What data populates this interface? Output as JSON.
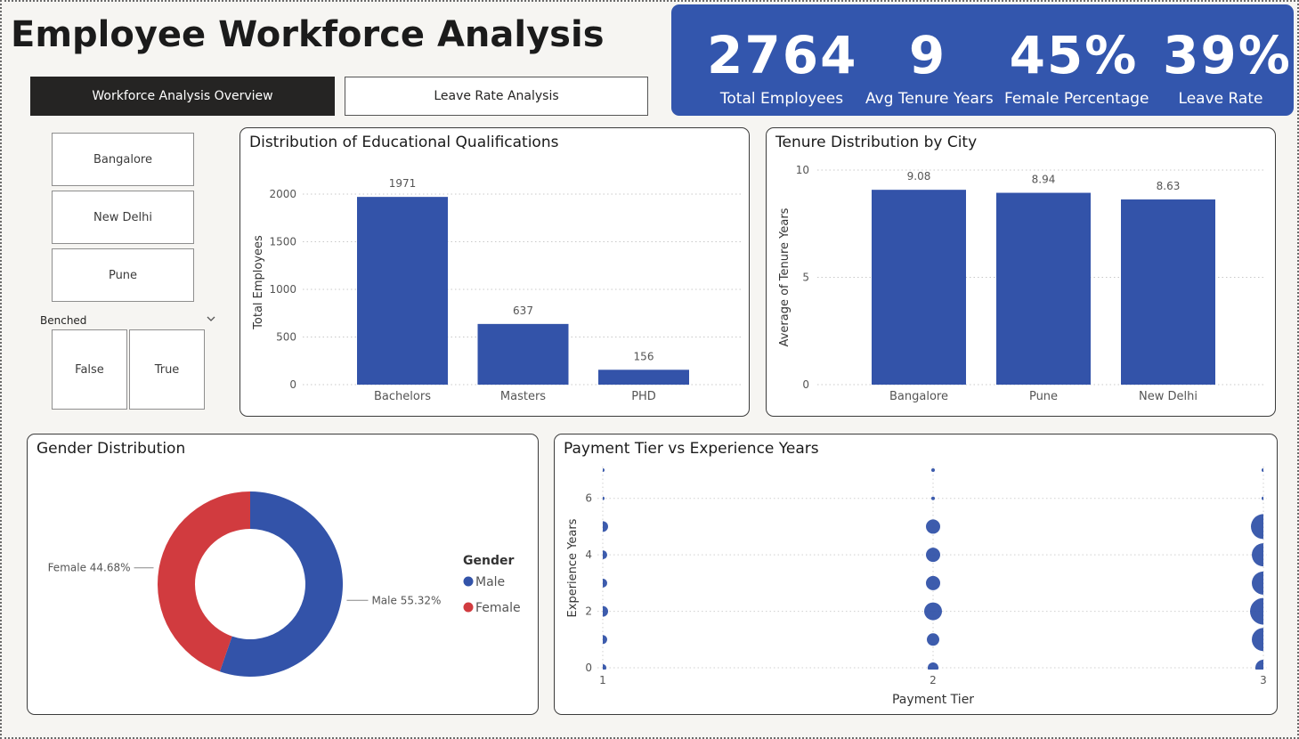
{
  "page": {
    "title": "Employee Workforce Analysis",
    "nav": {
      "active": "Workforce Analysis Overview",
      "inactive": "Leave Rate Analysis"
    }
  },
  "kpis": [
    {
      "value": "2764",
      "label": "Total Employees"
    },
    {
      "value": "9",
      "label": "Avg Tenure Years"
    },
    {
      "value": "45%",
      "label": "Female Percentage"
    },
    {
      "value": "39%",
      "label": "Leave Rate"
    }
  ],
  "colors": {
    "accent": "#3356ad",
    "bar": "#3353a9",
    "female": "#d13b3f",
    "dark": "#252423"
  },
  "slicers": {
    "cities": [
      "Bangalore",
      "New Delhi",
      "Pune"
    ],
    "benched": {
      "header": "Benched",
      "chevron_icon": "chevron-down-icon",
      "options": [
        "False",
        "True"
      ]
    }
  },
  "chart_data": [
    {
      "id": "education",
      "type": "bar",
      "title": "Distribution of Educational Qualifications",
      "xlabel": "",
      "ylabel": "Total Employees",
      "categories": [
        "Bachelors",
        "Masters",
        "PHD"
      ],
      "values": [
        1971,
        637,
        156
      ],
      "data_labels": [
        "1971",
        "637",
        "156"
      ],
      "yticks": [
        0,
        500,
        1000,
        1500,
        2000
      ],
      "ylim": [
        0,
        2150
      ],
      "grid": true
    },
    {
      "id": "tenure",
      "type": "bar",
      "title": "Tenure Distribution by City",
      "xlabel": "",
      "ylabel": "Average of Tenure Years",
      "categories": [
        "Bangalore",
        "Pune",
        "New Delhi"
      ],
      "values": [
        9.08,
        8.94,
        8.63
      ],
      "data_labels": [
        "9.08",
        "8.94",
        "8.63"
      ],
      "yticks": [
        0,
        5,
        10
      ],
      "ylim": [
        0,
        10
      ],
      "grid": true
    },
    {
      "id": "gender",
      "type": "pie",
      "subtype": "donut",
      "title": "Gender Distribution",
      "legend_title": "Gender",
      "legend_position": "right",
      "slices": [
        {
          "label": "Male",
          "value": 55.32,
          "data_label": "Male 55.32%",
          "color": "#3353a9"
        },
        {
          "label": "Female",
          "value": 44.68,
          "data_label": "Female 44.68%",
          "color": "#d13b3f"
        }
      ]
    },
    {
      "id": "payment",
      "type": "scatter",
      "title": "Payment Tier vs Experience Years",
      "xlabel": "Payment Tier",
      "ylabel": "Experience Years",
      "xticks": [
        1,
        2,
        3
      ],
      "yticks": [
        0,
        2,
        4,
        6
      ],
      "xlim": [
        1,
        3
      ],
      "ylim": [
        0,
        7
      ],
      "grid": true,
      "points": [
        {
          "x": 1,
          "y": 0,
          "size": 4
        },
        {
          "x": 1,
          "y": 1,
          "size": 5
        },
        {
          "x": 1,
          "y": 2,
          "size": 6
        },
        {
          "x": 1,
          "y": 3,
          "size": 5
        },
        {
          "x": 1,
          "y": 4,
          "size": 5
        },
        {
          "x": 1,
          "y": 5,
          "size": 6
        },
        {
          "x": 1,
          "y": 6,
          "size": 2
        },
        {
          "x": 1,
          "y": 7,
          "size": 2
        },
        {
          "x": 2,
          "y": 0,
          "size": 6
        },
        {
          "x": 2,
          "y": 1,
          "size": 7
        },
        {
          "x": 2,
          "y": 2,
          "size": 10
        },
        {
          "x": 2,
          "y": 3,
          "size": 8
        },
        {
          "x": 2,
          "y": 4,
          "size": 8
        },
        {
          "x": 2,
          "y": 5,
          "size": 8
        },
        {
          "x": 2,
          "y": 6,
          "size": 2
        },
        {
          "x": 2,
          "y": 7,
          "size": 2
        },
        {
          "x": 3,
          "y": 0,
          "size": 9
        },
        {
          "x": 3,
          "y": 1,
          "size": 13
        },
        {
          "x": 3,
          "y": 2,
          "size": 15
        },
        {
          "x": 3,
          "y": 3,
          "size": 13
        },
        {
          "x": 3,
          "y": 4,
          "size": 13
        },
        {
          "x": 3,
          "y": 5,
          "size": 14
        },
        {
          "x": 3,
          "y": 6,
          "size": 2
        },
        {
          "x": 3,
          "y": 7,
          "size": 2
        }
      ]
    }
  ]
}
